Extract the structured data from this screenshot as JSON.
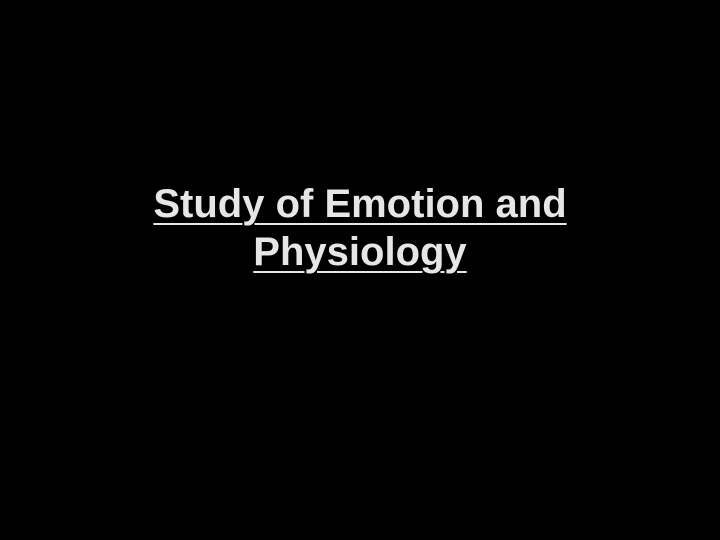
{
  "slide": {
    "background_color": "#000000",
    "text_color": "#e6e6e6",
    "title_lines": [
      "Study of Emotion and",
      "Physiology"
    ]
  }
}
